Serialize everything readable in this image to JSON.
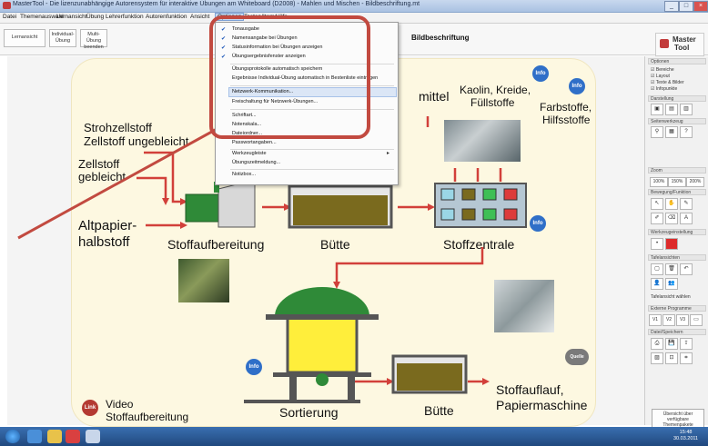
{
  "window": {
    "title": "MasterTool - Die lizenzunabhängige Autorensystem für interaktive Übungen am Whiteboard (D2008) - Mahlen und Mischen - Bildbeschriftung.mt",
    "controls": [
      "_",
      "□",
      "×"
    ]
  },
  "menubar": {
    "items": [
      "Datei",
      "Themenauswahl",
      "Lernansicht",
      "Übung",
      "Lehrerfunktion",
      "Autorenfunktion",
      "Ansicht",
      "Optionen",
      "Tasten/Items",
      "Hilfe"
    ],
    "active": "Optionen"
  },
  "toolbar": {
    "buttons": [
      {
        "label": "Lernansicht"
      },
      {
        "label": "Individual-Übung"
      },
      {
        "label": "Multi-Übung beenden"
      }
    ],
    "lesson_title": "Bildbeschriftung"
  },
  "logo": {
    "line1": "Master",
    "line2": "Tool"
  },
  "dropdown": {
    "items": [
      {
        "label": "Tonausgabe",
        "checked": true
      },
      {
        "label": "Namensangabe bei Übungen",
        "checked": true
      },
      {
        "label": "Statusinformation bei Übungen anzeigen",
        "checked": true
      },
      {
        "label": "Übungsergebnisfenster anzeigen",
        "checked": true
      },
      {
        "label": "Übungsprotokolle automatisch speichern",
        "checked": false
      },
      {
        "label": "Ergebnisse Individual-Übung automatisch in Bestenliste eintragen",
        "checked": false
      },
      {
        "label": "Netzwerk-Kommunikation...",
        "checked": false,
        "highlighted": true
      },
      {
        "label": "Freischaltung für Netzwerk-Übungen...",
        "checked": false
      },
      {
        "label": "Schriftart...",
        "checked": false
      },
      {
        "label": "Notenskala...",
        "checked": false
      },
      {
        "label": "Dateiordner...",
        "checked": false
      },
      {
        "label": "Passwortangaben...",
        "checked": false
      },
      {
        "label": "Werkzeugleiste",
        "checked": false,
        "submenu": true
      },
      {
        "label": "Übungszeitmeldung...",
        "checked": false
      },
      {
        "label": "Notizbox...",
        "checked": false
      }
    ]
  },
  "slide": {
    "labels": {
      "mittel": "mittel",
      "kaolin": "Kaolin, Kreide,",
      "fuellstoffe": "Füllstoffe",
      "farbstoffe": "Farbstoffe,",
      "hilfsstoffe": "Hilfsstoffe",
      "strohzellstoff": "Strohzellstoff",
      "zellstoff_ungebleicht": "Zellstoff ungebleicht",
      "zellstoff": "Zellstoff",
      "gebleicht": "gebleicht",
      "altpapier": "Altpapier-",
      "halbstoff": "halbstoff",
      "stoffaufbereitung": "Stoffaufbereitung",
      "buette1": "Bütte",
      "stoffzentrale": "Stoffzentrale",
      "sortierung": "Sortierung",
      "buette2": "Bütte",
      "stoffauflauf": "Stoffauflauf,",
      "papiermaschine": "Papiermaschine",
      "video": "Video",
      "video_sub": "Stoffaufbereitung"
    },
    "info_badge": "Info",
    "link_badge": "Link",
    "quelle_badge": "Quelle"
  },
  "right_panel": {
    "sections": [
      "Optionen",
      "Darstellung",
      "Seitenwerkzeug",
      "Zoom",
      "Bewegung/Funktion",
      "Werkzeugeinstellung",
      "Tafelansichten",
      "Externe Programme",
      "Datei/Speichern"
    ],
    "checks": [
      "Bereiche",
      "Layout",
      "Texte & Bilder",
      "Infopunkte"
    ],
    "zoom": [
      "100%",
      "150%",
      "200%"
    ],
    "tafel_label": "Tafelansicht wählen",
    "vx": [
      "V1",
      "V2",
      "V3"
    ],
    "overview": "Übersicht über verfügbare Themenpakete"
  },
  "taskbar": {
    "time": "15:48",
    "date": "30.03.2011"
  },
  "colors": {
    "accent_red": "#c24a40",
    "info_blue": "#2f6fc8",
    "slide_bg": "#fdf8e1"
  }
}
